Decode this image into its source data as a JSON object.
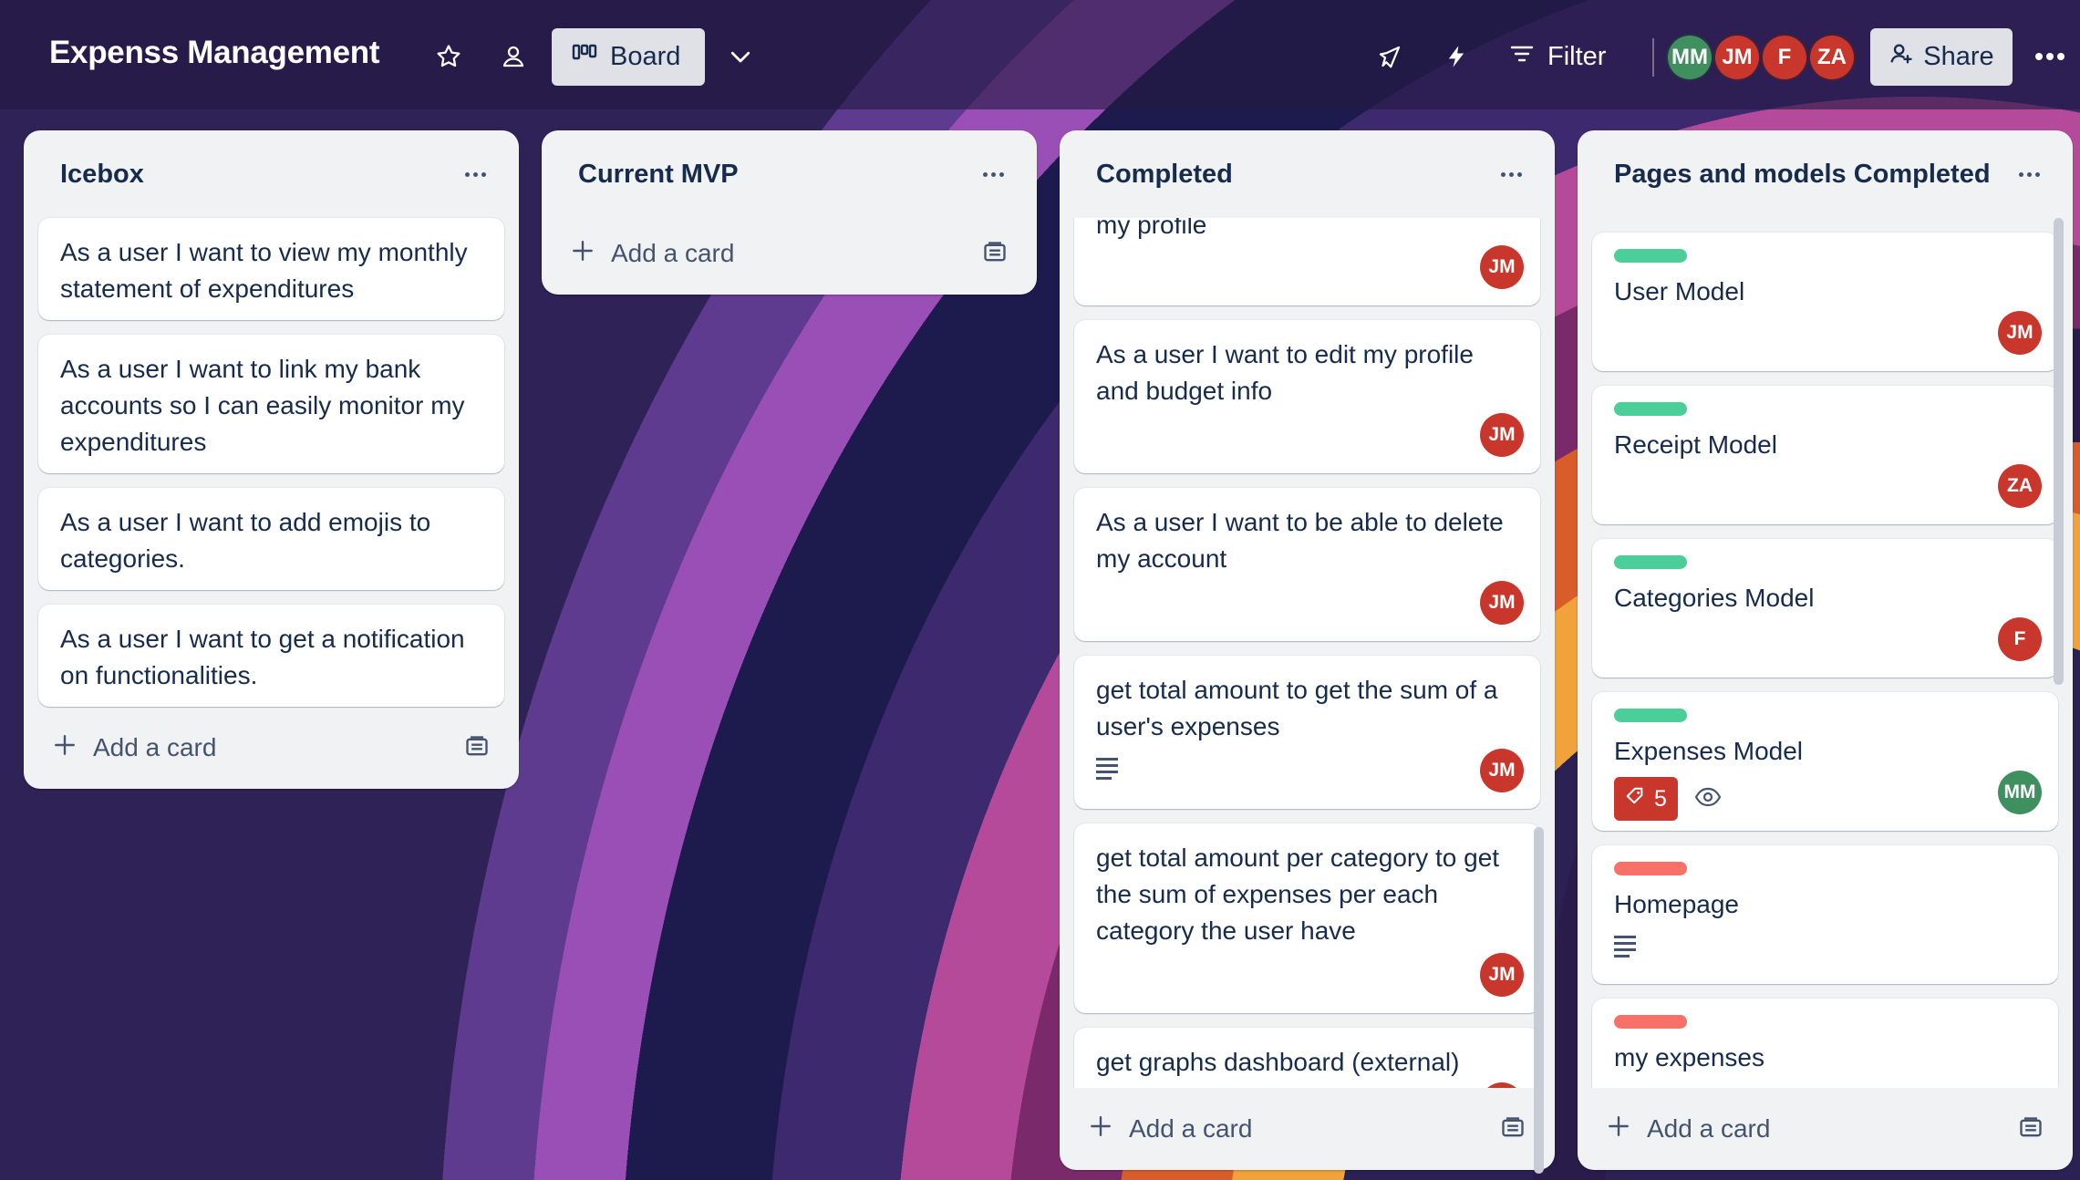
{
  "board": {
    "title": "Expenss Management",
    "view_label": "Board",
    "filter_label": "Filter",
    "share_label": "Share",
    "members": [
      {
        "initials": "MM",
        "color": "#3f8f5f"
      },
      {
        "initials": "JM",
        "color": "#c9372c"
      },
      {
        "initials": "F",
        "color": "#c9372c"
      },
      {
        "initials": "ZA",
        "color": "#c9372c"
      }
    ]
  },
  "lists": [
    {
      "title": "Icebox",
      "add_card_label": "Add a card",
      "cards": [
        {
          "text": "As a user I want to view my monthly statement of expenditures"
        },
        {
          "text": "As a user I want to link my bank accounts so I can easily monitor my expenditures"
        },
        {
          "text": "As a user I want to add emojis to categories."
        },
        {
          "text": "As a user I want to get a notification on functionalities."
        }
      ]
    },
    {
      "title": "Current MVP",
      "add_card_label": "Add a card",
      "cards": []
    },
    {
      "title": "Completed",
      "add_card_label": "Add a card",
      "cards": [
        {
          "text": "my profile",
          "member": "JM"
        },
        {
          "text": "As a user I want to edit my profile and budget info",
          "member": "JM"
        },
        {
          "text": "As a user I want to be able to delete my account",
          "member": "JM"
        },
        {
          "text": "get total amount to get the sum of a user's expenses",
          "member": "JM",
          "has_description": true
        },
        {
          "text": "get total amount per category to get the sum of expenses per each category the user have",
          "member": "JM"
        },
        {
          "text": "get graphs dashboard (external)",
          "member": "JM"
        }
      ]
    },
    {
      "title": "Pages and models Completed",
      "add_card_label": "Add a card",
      "cards": [
        {
          "text": "User Model",
          "label_color": "#4bce97",
          "member": "JM"
        },
        {
          "text": "Receipt Model",
          "label_color": "#4bce97",
          "member": "ZA"
        },
        {
          "text": "Categories Model",
          "label_color": "#4bce97",
          "member": "F"
        },
        {
          "text": "Expenses Model",
          "label_color": "#4bce97",
          "member": "MM",
          "badge_count": "5",
          "watching": true
        },
        {
          "text": "Homepage",
          "label_color": "#f87168",
          "has_description": true
        },
        {
          "text": "my expenses",
          "label_color": "#f87168",
          "has_description": true
        }
      ]
    }
  ],
  "colors": {
    "member_red": "#c9372c",
    "member_green": "#3f8f5f",
    "badge_red": "#c9372c"
  }
}
